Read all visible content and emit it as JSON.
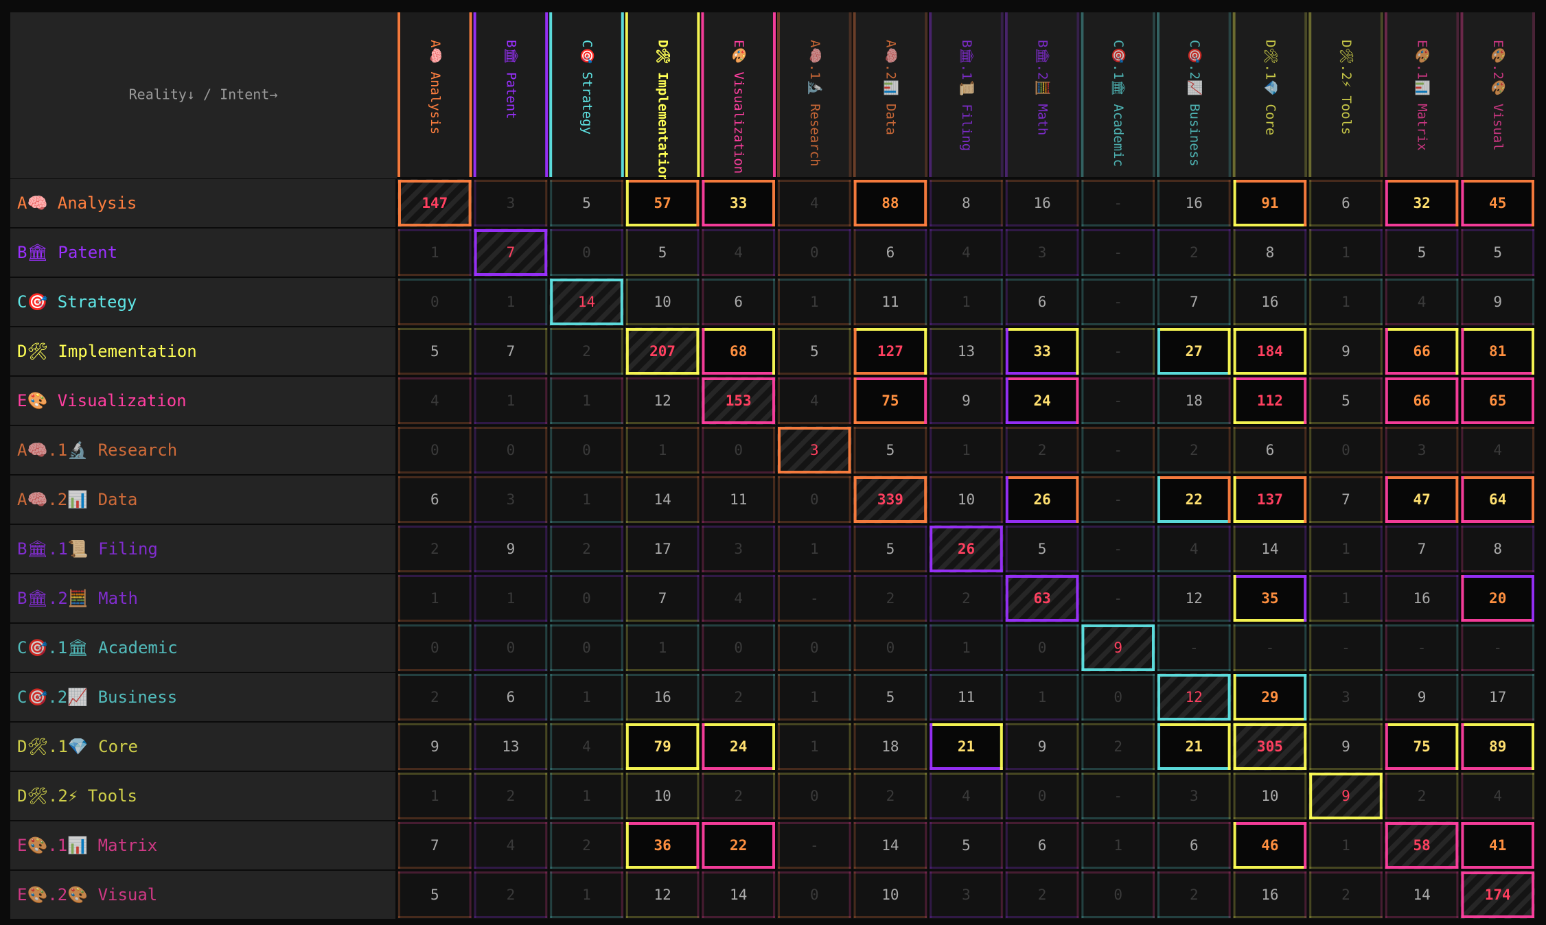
{
  "chart_data": {
    "type": "heatmap",
    "corner_label": "Reality↓ / Intent→",
    "colors": {
      "A": "#ff7f3f",
      "B": "#9b30ff",
      "C": "#5fe5e5",
      "D": "#ffff55",
      "E": "#ff3fa0",
      "value_hot": "#ff4060",
      "value_warm": "#ff9040",
      "value_mid": "#ffe070",
      "value_low": "#aaaaaa",
      "value_faint": "#3a3a3a"
    },
    "rows": [
      {
        "code": "A🧠",
        "name": "Analysis",
        "group": "A",
        "top": true
      },
      {
        "code": "B🏛",
        "name": "Patent",
        "group": "B",
        "top": true
      },
      {
        "code": "C🎯",
        "name": "Strategy",
        "group": "C",
        "top": true
      },
      {
        "code": "D🛠",
        "name": "Implementation",
        "group": "D",
        "top": true
      },
      {
        "code": "E🎨",
        "name": "Visualization",
        "group": "E",
        "top": true
      },
      {
        "code": "A🧠.1🔬",
        "name": "Research",
        "group": "A",
        "top": false
      },
      {
        "code": "A🧠.2📊",
        "name": "Data",
        "group": "A",
        "top": false
      },
      {
        "code": "B🏛.1📜",
        "name": "Filing",
        "group": "B",
        "top": false
      },
      {
        "code": "B🏛.2🧮",
        "name": "Math",
        "group": "B",
        "top": false
      },
      {
        "code": "C🎯.1🏛",
        "name": "Academic",
        "group": "C",
        "top": false
      },
      {
        "code": "C🎯.2📈",
        "name": "Business",
        "group": "C",
        "top": false
      },
      {
        "code": "D🛠.1💎",
        "name": "Core",
        "group": "D",
        "top": false
      },
      {
        "code": "D🛠.2⚡",
        "name": "Tools",
        "group": "D",
        "top": false
      },
      {
        "code": "E🎨.1📊",
        "name": "Matrix",
        "group": "E",
        "top": false
      },
      {
        "code": "E🎨.2🎨",
        "name": "Visual",
        "group": "E",
        "top": false
      }
    ],
    "columns": [
      {
        "code": "A🧠",
        "name": "Analysis",
        "group": "A",
        "top": true
      },
      {
        "code": "B🏛",
        "name": "Patent",
        "group": "B",
        "top": true
      },
      {
        "code": "C🎯",
        "name": "Strategy",
        "group": "C",
        "top": true
      },
      {
        "code": "D🛠",
        "name": "Implementation",
        "group": "D",
        "top": true
      },
      {
        "code": "E🎨",
        "name": "Visualization",
        "group": "E",
        "top": true
      },
      {
        "code": "A🧠.1🔬",
        "name": "Research",
        "group": "A",
        "top": false
      },
      {
        "code": "A🧠.2📊",
        "name": "Data",
        "group": "A",
        "top": false
      },
      {
        "code": "B🏛.1📜",
        "name": "Filing",
        "group": "B",
        "top": false
      },
      {
        "code": "B🏛.2🧮",
        "name": "Math",
        "group": "B",
        "top": false
      },
      {
        "code": "C🎯.1🏛",
        "name": "Academic",
        "group": "C",
        "top": false
      },
      {
        "code": "C🎯.2📈",
        "name": "Business",
        "group": "C",
        "top": false
      },
      {
        "code": "D🛠.1💎",
        "name": "Core",
        "group": "D",
        "top": false
      },
      {
        "code": "D🛠.2⚡",
        "name": "Tools",
        "group": "D",
        "top": false
      },
      {
        "code": "E🎨.1📊",
        "name": "Matrix",
        "group": "E",
        "top": false
      },
      {
        "code": "E🎨.2🎨",
        "name": "Visual",
        "group": "E",
        "top": false
      }
    ],
    "values": [
      [
        "147",
        "3",
        "5",
        "57",
        "33",
        "4",
        "88",
        "8",
        "16",
        "-",
        "16",
        "91",
        "6",
        "32",
        "45"
      ],
      [
        "1",
        "7",
        "0",
        "5",
        "4",
        "0",
        "6",
        "4",
        "3",
        "-",
        "2",
        "8",
        "1",
        "5",
        "5"
      ],
      [
        "0",
        "1",
        "14",
        "10",
        "6",
        "1",
        "11",
        "1",
        "6",
        "-",
        "7",
        "16",
        "1",
        "4",
        "9"
      ],
      [
        "5",
        "7",
        "2",
        "207",
        "68",
        "5",
        "127",
        "13",
        "33",
        "-",
        "27",
        "184",
        "9",
        "66",
        "81"
      ],
      [
        "4",
        "1",
        "1",
        "12",
        "153",
        "4",
        "75",
        "9",
        "24",
        "-",
        "18",
        "112",
        "5",
        "66",
        "65"
      ],
      [
        "0",
        "0",
        "0",
        "1",
        "0",
        "3",
        "5",
        "1",
        "2",
        "-",
        "2",
        "6",
        "0",
        "3",
        "4"
      ],
      [
        "6",
        "3",
        "1",
        "14",
        "11",
        "0",
        "339",
        "10",
        "26",
        "-",
        "22",
        "137",
        "7",
        "47",
        "64"
      ],
      [
        "2",
        "9",
        "2",
        "17",
        "3",
        "1",
        "5",
        "26",
        "5",
        "-",
        "4",
        "14",
        "1",
        "7",
        "8"
      ],
      [
        "1",
        "1",
        "0",
        "7",
        "4",
        "-",
        "2",
        "2",
        "63",
        "-",
        "12",
        "35",
        "1",
        "16",
        "20"
      ],
      [
        "0",
        "0",
        "0",
        "1",
        "0",
        "0",
        "0",
        "1",
        "0",
        "9",
        "-",
        "-",
        "-",
        "-",
        "-"
      ],
      [
        "2",
        "6",
        "1",
        "16",
        "2",
        "1",
        "5",
        "11",
        "1",
        "0",
        "12",
        "29",
        "3",
        "9",
        "17"
      ],
      [
        "9",
        "13",
        "4",
        "79",
        "24",
        "1",
        "18",
        "21",
        "9",
        "2",
        "21",
        "305",
        "9",
        "75",
        "89"
      ],
      [
        "1",
        "2",
        "1",
        "10",
        "2",
        "0",
        "2",
        "4",
        "0",
        "-",
        "3",
        "10",
        "9",
        "2",
        "4"
      ],
      [
        "7",
        "4",
        "2",
        "36",
        "22",
        "-",
        "14",
        "5",
        "6",
        "1",
        "6",
        "46",
        "1",
        "58",
        "41"
      ],
      [
        "5",
        "2",
        "1",
        "12",
        "14",
        "0",
        "10",
        "3",
        "2",
        "0",
        "2",
        "16",
        "2",
        "14",
        "174"
      ]
    ]
  }
}
